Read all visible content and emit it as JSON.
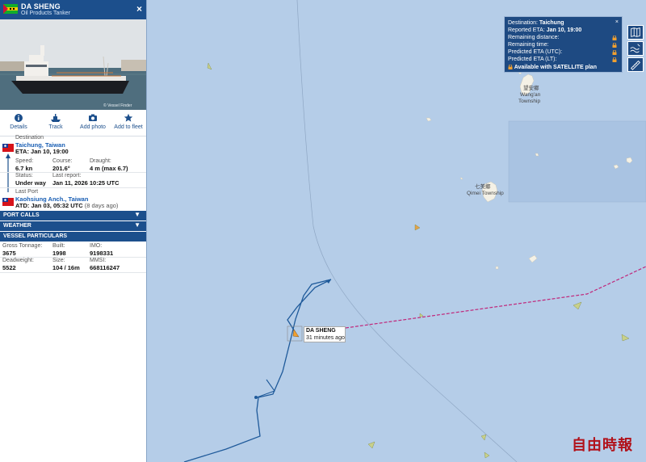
{
  "vessel": {
    "name": "DA SHENG",
    "type": "Oil Products Tanker",
    "photo_credit": "© Vessel Finder"
  },
  "actions": [
    {
      "label": "Details",
      "icon": "info-icon"
    },
    {
      "label": "Track",
      "icon": "ship-track-icon"
    },
    {
      "label": "Add photo",
      "icon": "camera-icon"
    },
    {
      "label": "Add to fleet",
      "icon": "star-icon"
    }
  ],
  "voyage": {
    "destination_label": "Destination",
    "destination": "Taichung, Taiwan",
    "eta": "ETA: Jan 10, 19:00",
    "speed_label": "Speed:",
    "speed": "6.7 kn",
    "course_label": "Course:",
    "course": "201.6°",
    "draught_label": "Draught:",
    "draught": "4 m (max 6.7)",
    "status_label": "Status:",
    "status": "Under way",
    "last_report_label": "Last report:",
    "last_report": "Jan 11, 2026 10:25 UTC",
    "last_port_label": "Last Port",
    "last_port": "Kaohsiung Anch., Taiwan",
    "atd": "ATD: Jan 03, 05:32 UTC",
    "atd_ago": "(8 days ago)"
  },
  "sections": {
    "port_calls": "PORT CALLS",
    "weather": "WEATHER",
    "particulars": "VESSEL PARTICULARS"
  },
  "particulars": {
    "gross_tonnage_label": "Gross Tonnage:",
    "gross_tonnage": "3675",
    "built_label": "Built:",
    "built": "1998",
    "imo_label": "IMO:",
    "imo": "9198331",
    "deadweight_label": "Deadweight:",
    "deadweight": "5522",
    "size_label": "Size:",
    "size": "104 / 16m",
    "mmsi_label": "MMSI:",
    "mmsi": "668116247"
  },
  "eta_popup": {
    "destination_label": "Destination:",
    "destination": "Taichung",
    "reported_eta_label": "Reported ETA:",
    "reported_eta": "Jan 10, 19:00",
    "remaining_distance": "Remaining distance:",
    "remaining_time": "Remaining time:",
    "predicted_utc": "Predicted ETA (UTC):",
    "predicted_lt": "Predicted ETA (LT):",
    "satellite": "Available with SATELLITE plan",
    "close": "×"
  },
  "map": {
    "vessel_label_name": "DA SHENG",
    "vessel_label_time": "31 minutes ago",
    "places": [
      {
        "name": "望安鄉",
        "kind": "zh"
      },
      {
        "name": "Wang'an",
        "kind": "en"
      },
      {
        "name": "Township",
        "kind": "en"
      },
      {
        "name": "七美鄉",
        "kind": "zh"
      },
      {
        "name": "Qimei Township",
        "kind": "en"
      }
    ],
    "water_color": "#b5cde8",
    "route_color": "#c0267a",
    "track_color": "#1f5a9a"
  },
  "tools": [
    "map-icon",
    "weather-waves-icon",
    "ruler-icon"
  ],
  "watermark": "自由時報"
}
